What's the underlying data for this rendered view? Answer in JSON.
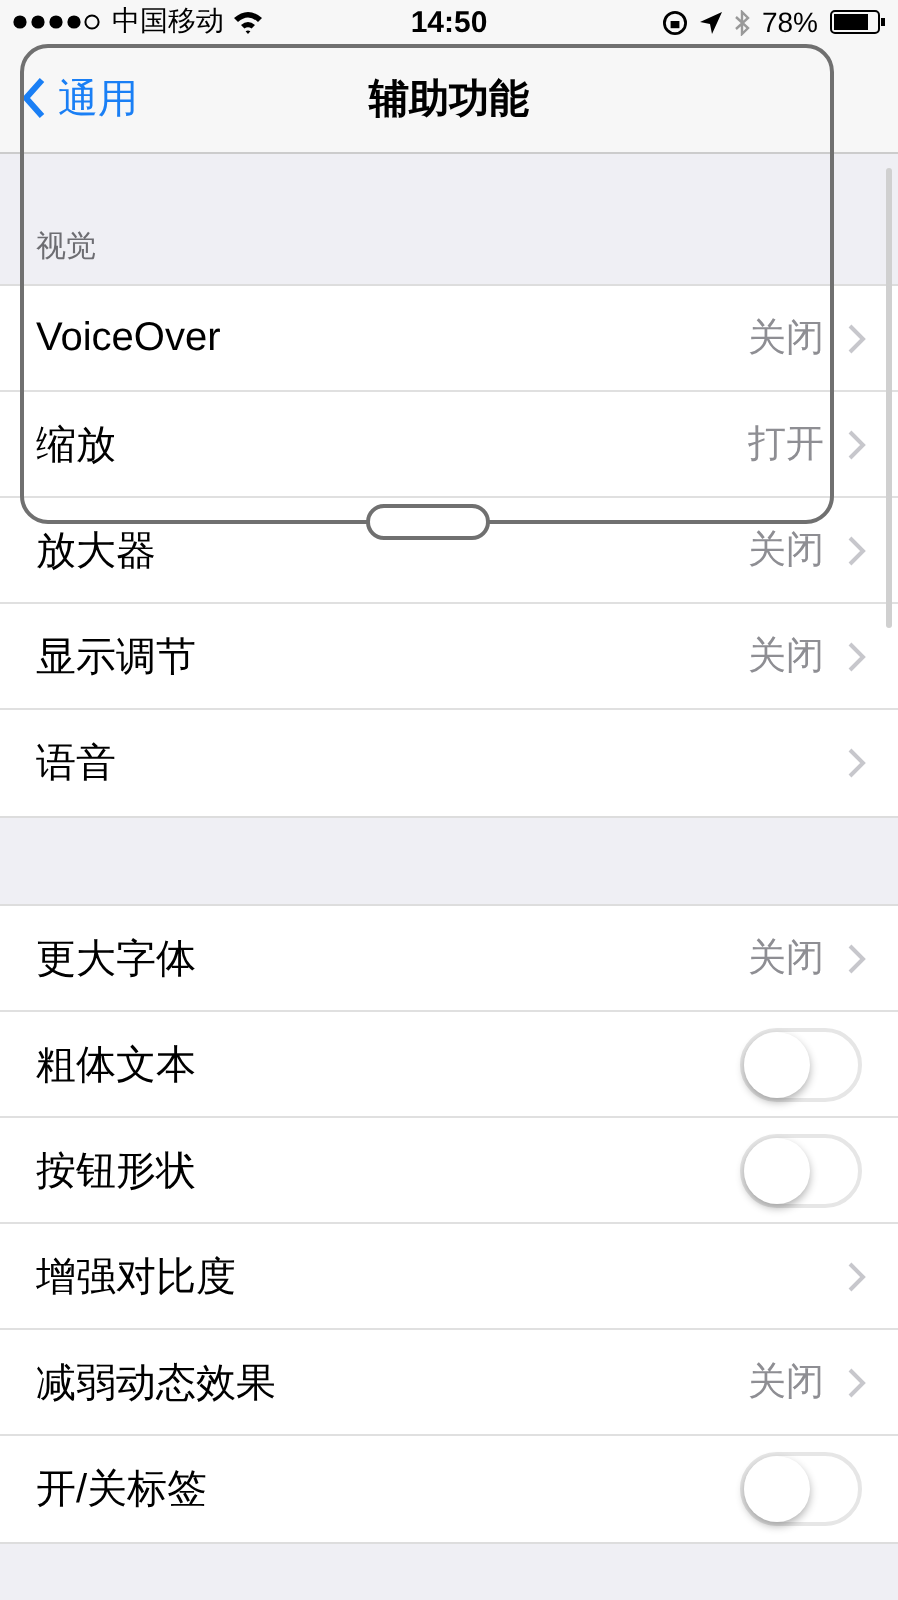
{
  "status_bar": {
    "carrier": "中国移动",
    "time": "14:50",
    "battery": "78%"
  },
  "nav_bar": {
    "back": "通用",
    "title": "辅助功能"
  },
  "sections": [
    {
      "header": "视觉",
      "rows": [
        {
          "kind": "link",
          "label": "VoiceOver",
          "value": "关闭"
        },
        {
          "kind": "link",
          "label": "缩放",
          "value": "打开"
        },
        {
          "kind": "link",
          "label": "放大器",
          "value": "关闭"
        },
        {
          "kind": "link",
          "label": "显示调节",
          "value": "关闭"
        },
        {
          "kind": "link",
          "label": "语音"
        }
      ]
    },
    {
      "rows": [
        {
          "kind": "link",
          "label": "更大字体",
          "value": "关闭"
        },
        {
          "kind": "toggle",
          "label": "粗体文本",
          "on": false
        },
        {
          "kind": "toggle",
          "label": "按钮形状",
          "on": false
        },
        {
          "kind": "link",
          "label": "增强对比度"
        },
        {
          "kind": "link",
          "label": "减弱动态效果",
          "value": "关闭"
        },
        {
          "kind": "toggle",
          "label": "开/关标签",
          "on": false
        }
      ]
    }
  ]
}
